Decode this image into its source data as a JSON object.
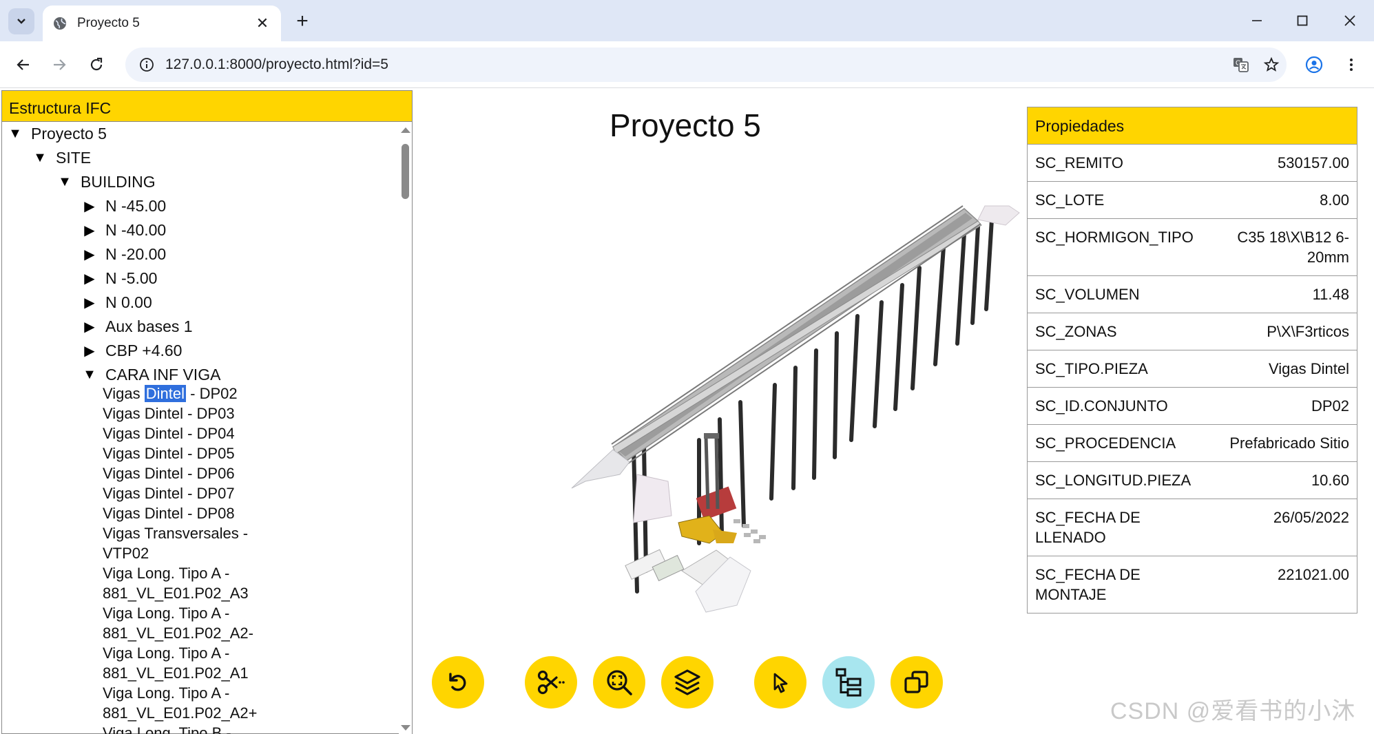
{
  "browser": {
    "tab_title": "Proyecto 5",
    "url": "127.0.0.1:8000/proyecto.html?id=5"
  },
  "tree": {
    "header": "Estructura IFC",
    "nodes": [
      {
        "label": "Proyecto 5",
        "level": 0,
        "expanded": true
      },
      {
        "label": "SITE",
        "level": 1,
        "expanded": true
      },
      {
        "label": "BUILDING",
        "level": 2,
        "expanded": true
      },
      {
        "label": "N -45.00",
        "level": 3,
        "expanded": false
      },
      {
        "label": "N -40.00",
        "level": 3,
        "expanded": false
      },
      {
        "label": "N -20.00",
        "level": 3,
        "expanded": false
      },
      {
        "label": "N -5.00",
        "level": 3,
        "expanded": false
      },
      {
        "label": "N 0.00",
        "level": 3,
        "expanded": false
      },
      {
        "label": "Aux bases 1",
        "level": 3,
        "expanded": false
      },
      {
        "label": "CBP +4.60",
        "level": 3,
        "expanded": false
      },
      {
        "label": "CARA INF VIGA",
        "level": 3,
        "expanded": true
      }
    ],
    "selected_leaf": {
      "prefix": "Vigas",
      "highlight": "Dintel",
      "suffix": "- DP02"
    },
    "leaves": [
      "Vigas Dintel - DP03",
      "Vigas Dintel - DP04",
      "Vigas Dintel - DP05",
      "Vigas Dintel - DP06",
      "Vigas Dintel - DP07",
      "Vigas Dintel - DP08",
      "Vigas Transversales -",
      "VTP02",
      "Viga Long. Tipo A -",
      "881_VL_E01.P02_A3",
      "Viga Long. Tipo A -",
      "881_VL_E01.P02_A2-",
      "Viga Long. Tipo A -",
      "881_VL_E01.P02_A1",
      "Viga Long. Tipo A -",
      "881_VL_E01.P02_A2+",
      "Viga Long. Tipo B -"
    ]
  },
  "project_title": "Proyecto 5",
  "properties": {
    "header": "Propiedades",
    "rows": [
      {
        "key": "SC_REMITO",
        "value": "530157.00"
      },
      {
        "key": "SC_LOTE",
        "value": "8.00"
      },
      {
        "key": "SC_HORMIGON_TIPO",
        "value": "C35 18\\X\\B12 6-20mm"
      },
      {
        "key": "SC_VOLUMEN",
        "value": "11.48"
      },
      {
        "key": "SC_ZONAS",
        "value": "P\\X\\F3rticos"
      },
      {
        "key": "SC_TIPO.PIEZA",
        "value": "Vigas Dintel"
      },
      {
        "key": "SC_ID.CONJUNTO",
        "value": "DP02"
      },
      {
        "key": "SC_PROCEDENCIA",
        "value": "Prefabricado Sitio"
      },
      {
        "key": "SC_LONGITUD.PIEZA",
        "value": "10.60"
      },
      {
        "key": "SC_FECHA DE LLENADO",
        "value": "26/05/2022"
      },
      {
        "key": "SC_FECHA DE MONTAJE",
        "value": "221021.00"
      }
    ]
  },
  "tools": [
    {
      "name": "reset-view",
      "icon": "undo-icon"
    },
    {
      "name": "section-cut",
      "icon": "scissors-icon"
    },
    {
      "name": "zoom-fit",
      "icon": "zoom-icon"
    },
    {
      "name": "layers",
      "icon": "layers-icon"
    },
    {
      "name": "select",
      "icon": "cursor-icon"
    },
    {
      "name": "tree",
      "icon": "tree-icon",
      "active": true
    },
    {
      "name": "clone",
      "icon": "copy-icon"
    }
  ],
  "watermark": "CSDN @爱看书的小沐",
  "colors": {
    "accent": "#ffd500",
    "active_tool": "#a8e6ef",
    "selection": "#2f6fdd"
  }
}
